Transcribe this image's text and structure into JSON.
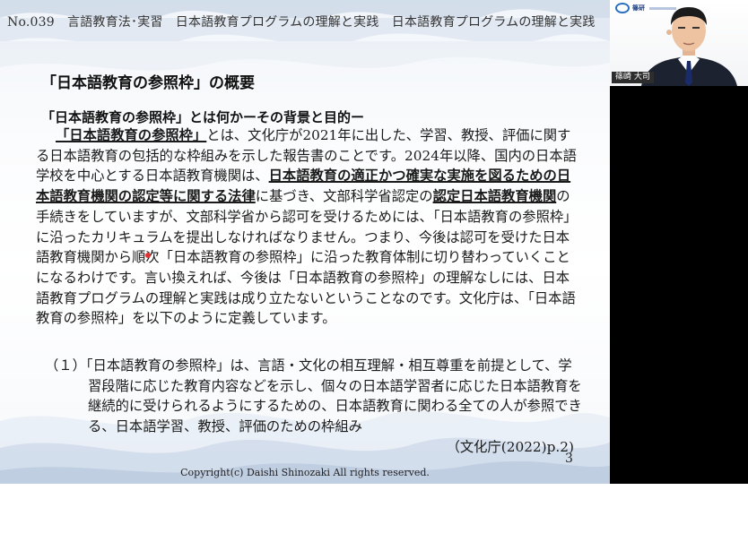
{
  "slide": {
    "header": "No.039　言語教育法･実習　日本語教育プログラムの理解と実践　日本語教育プログラムの理解と実践",
    "heading": "「日本語教育の参照枠」の概要",
    "subheading": "「日本語教育の参照枠」とは何かーその背景と目的ー",
    "body": {
      "p1_em": "「日本語教育の参照枠」",
      "p1_a": "とは、文化庁が2021年に出した、学習、教授、評価に関する日本語教育の包括的な枠組みを示した報告書のことです。2024年以降、国内の日本語学校を中心とする日本語教育機関は、",
      "p1_em2": "日本語教育の適正かつ確実な実施を図るための日本語教育機関の認定等に関する法律",
      "p1_b": "に基づき、文部科学省認定の",
      "p1_em3": "認定日本語教育機関",
      "p1_c": "の手続きをしていますが、文部科学省から認可を受けるためには、「日本語教育の参照枠」に沿ったカリキュラムを提出しなければなりません。つまり、今後は認可を受けた日本語教育機関から順次「日本語教育の参照枠」に沿った教育体制に切り替わっていくことになるわけです。言い換えれば、今後は「日本語教育の参照枠」の理解なしには、日本語教育プログラムの理解と実践は成り立たないということなのです。文化庁は、「日本語教育の参照枠」を以下のように定義しています。"
    },
    "definition": {
      "number": "（１）",
      "text": "「日本語教育の参照枠」は、言語・文化の相互理解・相互尊重を前提として、学習段階に応じた教育内容などを示し、個々の日本語学習者に応じた日本語教育を継続的に受けられるようにするための、日本語教育に関わる全ての人が参照できる、日本語学習、教授、評価のための枠組み",
      "citation": "（文化庁(2022)p.2)"
    },
    "page_number": "3",
    "copyright": "Copyright(c) Daishi Shinozaki All rights reserved."
  },
  "video": {
    "logo_text": "篠研",
    "name_tag": "篠崎 大司"
  },
  "colors": {
    "slide_background": "#f6f8fb",
    "side_panel": "#000000",
    "pointer": "#e03030"
  }
}
